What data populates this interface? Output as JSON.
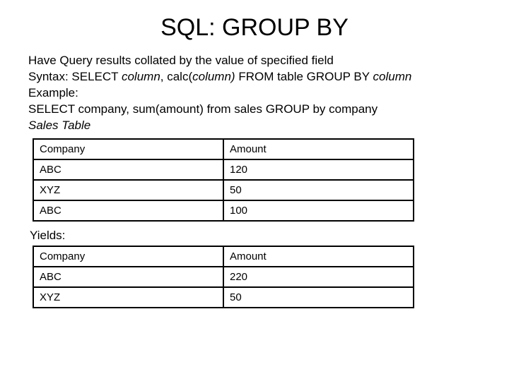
{
  "title": "SQL: GROUP BY",
  "desc_line1": "Have Query results collated by the value of specified field",
  "desc_line2_prefix": "Syntax: SELECT ",
  "desc_line2_col": "column",
  "desc_line2_mid1": ", calc(",
  "desc_line2_col2": "column)",
  "desc_line2_mid2": " FROM table GROUP BY ",
  "desc_line2_col3": "column",
  "desc_line3": "Example:",
  "desc_line4": "SELECT company, sum(amount) from sales GROUP by company",
  "sales_label": "Sales Table",
  "yields_label": "Yields:",
  "table1": {
    "headers": [
      "Company",
      "Amount"
    ],
    "rows": [
      [
        "ABC",
        "120"
      ],
      [
        "XYZ",
        "50"
      ],
      [
        "ABC",
        "100"
      ]
    ]
  },
  "table2": {
    "headers": [
      "Company",
      "Amount"
    ],
    "rows": [
      [
        "ABC",
        "220"
      ],
      [
        "XYZ",
        "50"
      ]
    ]
  },
  "chart_data": [
    {
      "type": "table",
      "title": "Sales Table",
      "columns": [
        "Company",
        "Amount"
      ],
      "rows": [
        {
          "Company": "ABC",
          "Amount": 120
        },
        {
          "Company": "XYZ",
          "Amount": 50
        },
        {
          "Company": "ABC",
          "Amount": 100
        }
      ]
    },
    {
      "type": "table",
      "title": "Yields",
      "columns": [
        "Company",
        "Amount"
      ],
      "rows": [
        {
          "Company": "ABC",
          "Amount": 220
        },
        {
          "Company": "XYZ",
          "Amount": 50
        }
      ]
    }
  ]
}
